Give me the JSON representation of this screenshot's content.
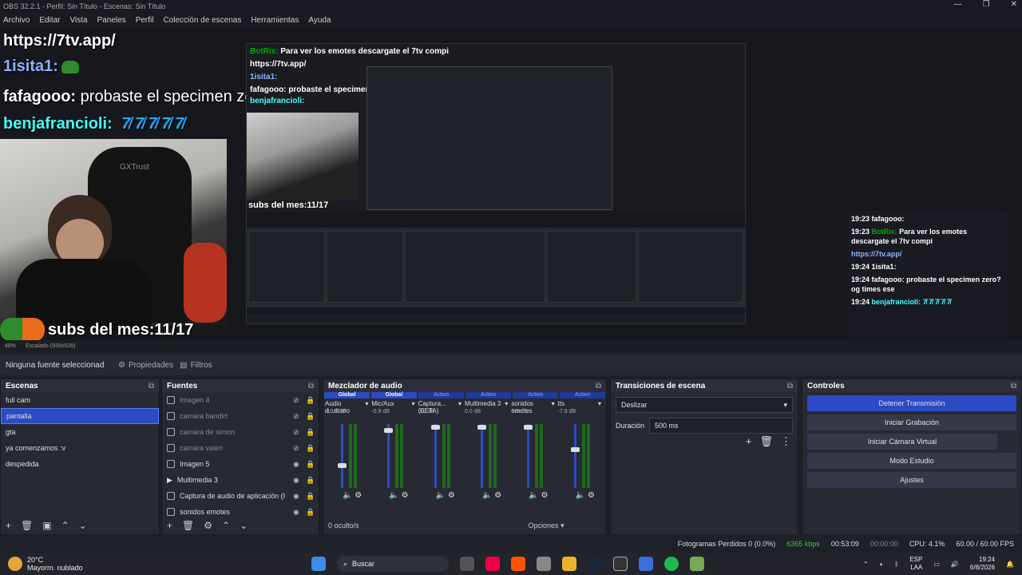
{
  "window": {
    "title": "OBS 32.2.1 - Perfil: Sin Título - Escenas: Sin Título"
  },
  "menu": [
    "Archivo",
    "Editar",
    "Vista",
    "Paneles",
    "Perfil",
    "Colección de escenas",
    "Herramientas",
    "Ayuda"
  ],
  "preview": {
    "chat": [
      {
        "user": "BotRix:",
        "text": "Para ver los emotes descargate el 7tv compi"
      },
      {
        "user": "",
        "text": "https://7tv.app/"
      },
      {
        "user": "1isita1:",
        "text": ""
      },
      {
        "user": "fafagooo:",
        "text": "probaste el specimen zero? og times ese"
      },
      {
        "user": "benjafrancioli:",
        "text": "7̸ 7̸ 7̸ 7̸ 7̸"
      }
    ],
    "subs": "subs del mes:11/17",
    "cam_brand": "GXTrust",
    "nested_subs": "subs del mes:11/17",
    "zoom": "48%",
    "scaled": "Escalado (939x528)",
    "right_chat": [
      {
        "time": "19:23",
        "user": "fafagooo:",
        "text": ""
      },
      {
        "time": "19:23",
        "user": "BotRix:",
        "text": "Para ver los emotes descargate el 7tv compi"
      },
      {
        "time": "",
        "user": "",
        "text": "https://7tv.app/"
      },
      {
        "time": "19:24",
        "user": "1isita1:",
        "text": ""
      },
      {
        "time": "19:24",
        "user": "fafagooo:",
        "text": "probaste el specimen zero? og times ese"
      },
      {
        "time": "19:24",
        "user": "benjafrancioli:",
        "text": "7̸ 7̸ 7̸ 7̸ 7̸"
      }
    ]
  },
  "sourcebar": {
    "none": "Ninguna fuente seleccionad",
    "props": "Propiedades",
    "filters": "Filtros"
  },
  "scenes": {
    "title": "Escenas",
    "items": [
      {
        "label": "full cam",
        "selected": false
      },
      {
        "label": "pantalla",
        "selected": true
      },
      {
        "label": "gta",
        "selected": false
      },
      {
        "label": "ya comenzamos :v",
        "selected": false
      },
      {
        "label": "despedida",
        "selected": false
      }
    ]
  },
  "sources": {
    "title": "Fuentes",
    "items": [
      {
        "label": "Imagen 4",
        "visible": false
      },
      {
        "label": "camara bandirt",
        "visible": false
      },
      {
        "label": "camara de simon",
        "visible": false
      },
      {
        "label": "camara valen",
        "visible": false
      },
      {
        "label": "Imagen 5",
        "visible": true
      },
      {
        "label": "Multimedia 3",
        "visible": true
      },
      {
        "label": "Captura de audio de aplicación (I",
        "visible": true
      },
      {
        "label": "sonidos emotes",
        "visible": true
      }
    ]
  },
  "mixer": {
    "title": "Mezclador de audio",
    "tabs": [
      "Global",
      "Global",
      "Activo",
      "Activo",
      "Activo",
      "Activo"
    ],
    "channels": [
      {
        "name": "Audio d...ritorio",
        "db": "-19.6 dB",
        "level": 0.35
      },
      {
        "name": "Mic/Aux",
        "db": "-0.9 dB",
        "level": 0.9
      },
      {
        "name": "Captura... (BETA)",
        "db": "0.0 dB",
        "level": 0.95
      },
      {
        "name": "Multimedia 3",
        "db": "0.0 dB",
        "level": 0.95
      },
      {
        "name": "sonidos emotes",
        "db": "0.0 dB",
        "level": 0.95
      },
      {
        "name": "tts",
        "db": "-7.9 dB",
        "level": 0.6
      }
    ],
    "hidden": "0 oculto/s",
    "options": "Opciones"
  },
  "transitions": {
    "title": "Transiciones de escena",
    "type": "Deslizar",
    "duration_label": "Duración",
    "duration": "500 ms"
  },
  "controls": {
    "title": "Controles",
    "buttons": [
      "Detener Transmisión",
      "Iniciar Grabación",
      "Iniciar Cámara Virtual",
      "Modo Estudio",
      "Ajustes"
    ]
  },
  "status": {
    "dropped": "Fotogramas Perdidos 0 (0.0%)",
    "bitrate": "6365 kbps",
    "stream_time": "00:53:09",
    "rec_time": "00:00:00",
    "cpu": "CPU: 4.1%",
    "fps": "60.00 / 60.00 FPS"
  },
  "taskbar": {
    "temp": "20°C",
    "weather": "Mayorm. nublado",
    "search": "Buscar",
    "lang1": "ESP",
    "lang2": "LAA",
    "time": "19:24",
    "date": "6/8/2026"
  },
  "colors": {
    "accent": "#2b4ac4",
    "bg": "#1f2129",
    "panel": "#272a33"
  }
}
